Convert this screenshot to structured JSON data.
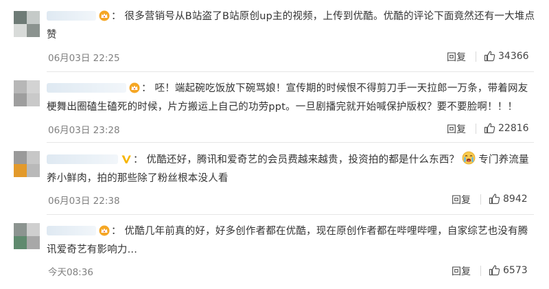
{
  "comments": [
    {
      "text": "很多营销号从B站盗了B站原创up主的视频，上传到优酷。优酷的评论下面竟然还有一大堆点赞",
      "time": "06月03日 22:25",
      "reply_label": "回复",
      "likes": "34366",
      "badge_icon": "crown-icon"
    },
    {
      "text": "呸！端起碗吃饭放下碗骂娘！宣传期的时候恨不得剪刀手一天拉郎一万条，带着网友梗舞出圈磕生磕死的时候，片方搬运上自己的功劳ppt。一旦剧播完就开始喊保护版权？要不要脸啊！！！",
      "time": "06月03日 23:28",
      "reply_label": "回复",
      "likes": "22816",
      "badge_icon": "crown-icon"
    },
    {
      "text_before_emoji": "优酷还好，腾讯和爱奇艺的会员费越来越贵，投资拍的都是什么东西？",
      "text_after_emoji": "专门养流量养小鲜肉，拍的那些除了粉丝根本没人看",
      "time": "06月03日 22:38",
      "reply_label": "回复",
      "likes": "8942",
      "badge_icon": "verified-v-icon"
    },
    {
      "text": "优酷几年前真的好，好多创作者都在优酷，现在原创作者都在哔哩哔哩，自家综艺也没有腾讯爱奇艺有影响力...",
      "time": "今天08:36",
      "reply_label": "回复",
      "likes": "6573",
      "badge_icon": "crown-icon"
    }
  ],
  "colors": {
    "text": "#333333",
    "meta": "#808080",
    "divider": "#e6e6e6",
    "crown": "#f5a623",
    "verified": "#f7b500"
  }
}
